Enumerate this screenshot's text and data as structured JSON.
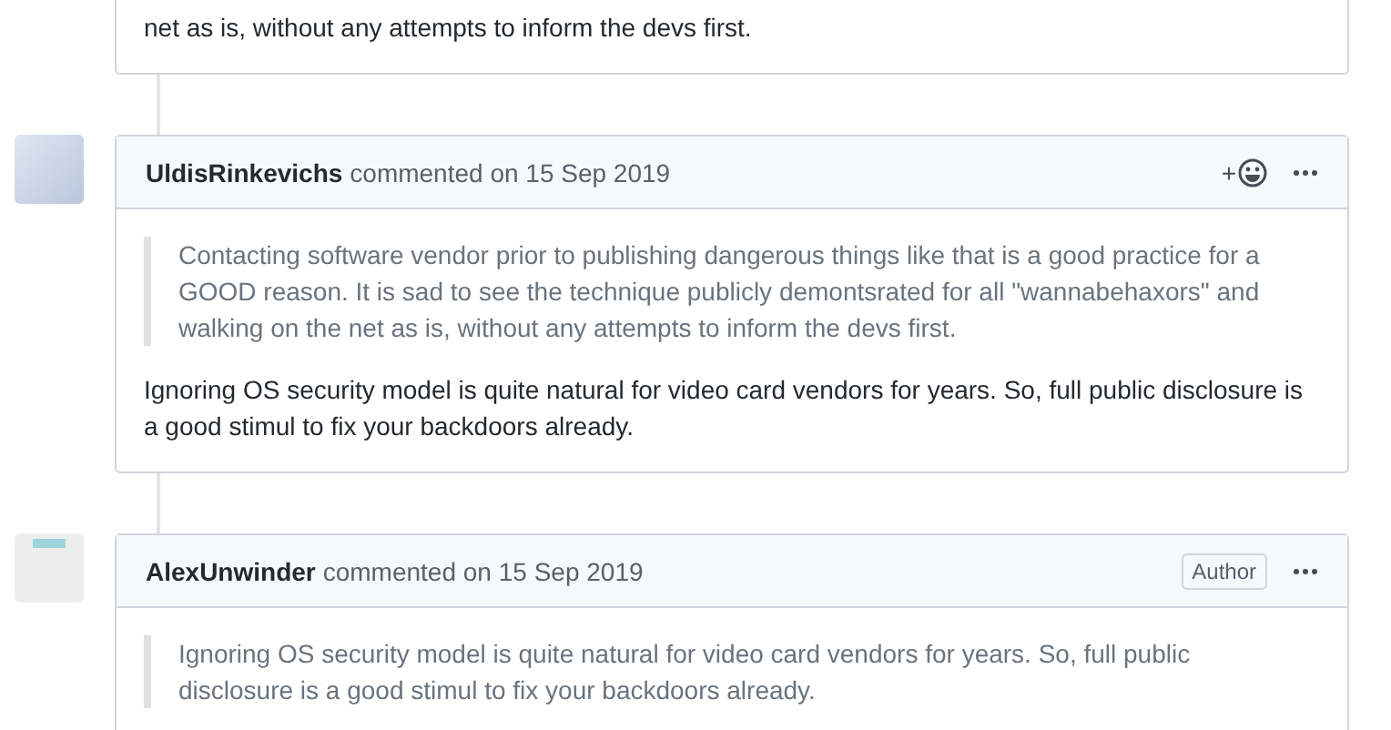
{
  "comments": [
    {
      "body": [
        {
          "kind": "paragraph",
          "text": "net as is, without any attempts to inform the devs first."
        }
      ]
    },
    {
      "avatar": {
        "kind": "photo"
      },
      "author": "UldisRinkevichs",
      "meta": "commented on 15 Sep 2019",
      "reaction_button": "+",
      "body": [
        {
          "kind": "quote",
          "text": "Contacting software vendor prior to publishing dangerous things like that is a good practice for a GOOD reason. It is sad to see the technique publicly demontsrated for all \"wannabehaxors\" and walking on the net as is, without any attempts to inform the devs first."
        },
        {
          "kind": "paragraph",
          "text": "Ignoring OS security model is quite natural for video card vendors for years. So, full public disclosure is a good stimul to fix your backdoors already."
        }
      ]
    },
    {
      "avatar": {
        "kind": "pattern"
      },
      "author": "AlexUnwinder",
      "meta": "commented on 15 Sep 2019",
      "badge": "Author",
      "body": [
        {
          "kind": "quote",
          "text": "Ignoring OS security model is quite natural for video card vendors for years. So, full public disclosure is a good stimul to fix your backdoors already."
        }
      ]
    }
  ]
}
